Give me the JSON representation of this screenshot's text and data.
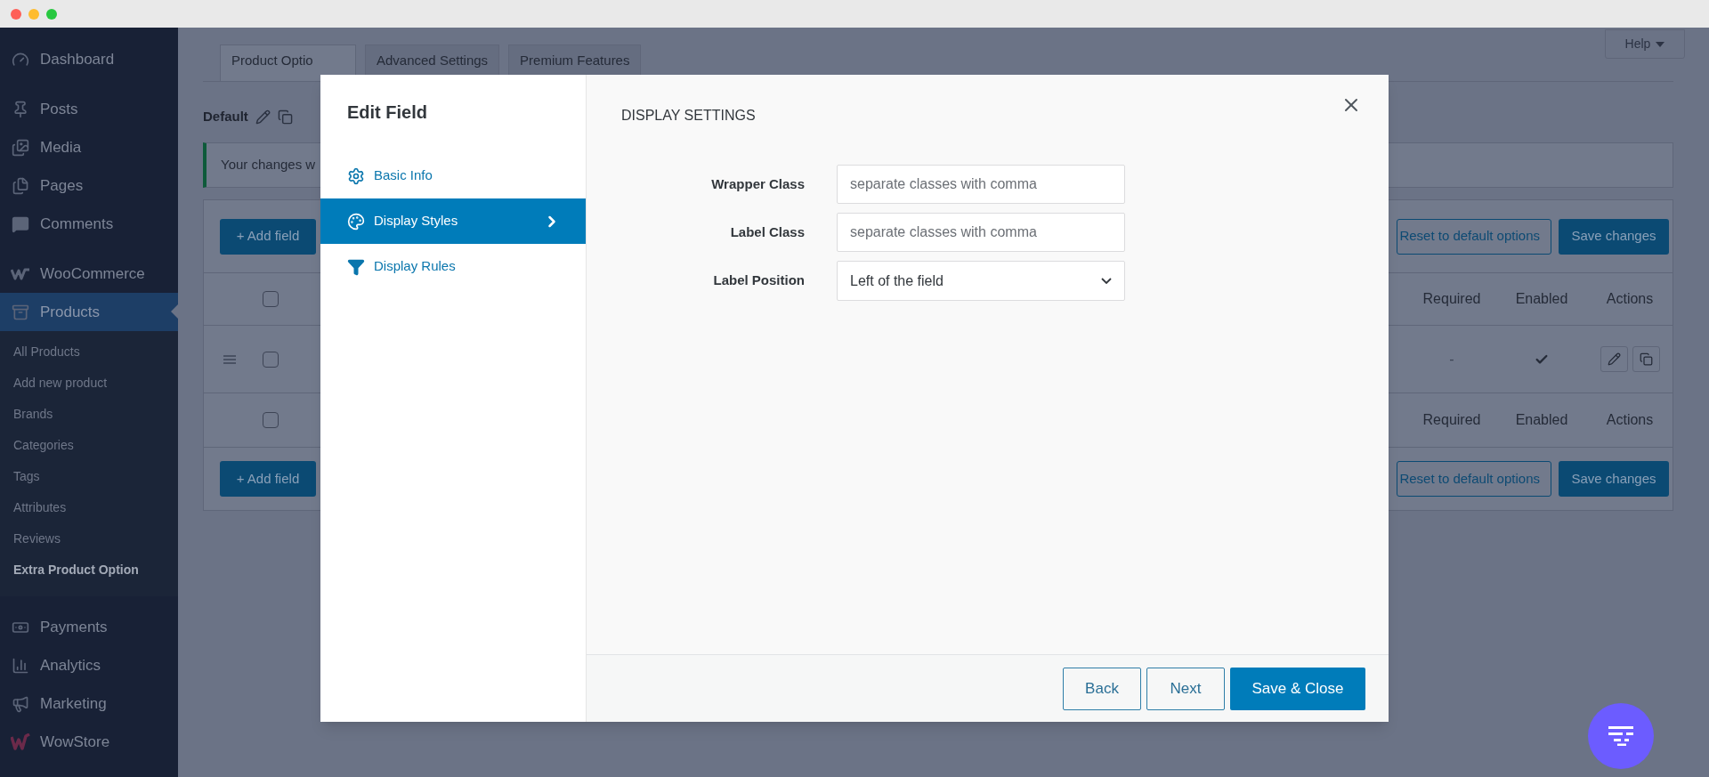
{
  "window": {
    "controls": [
      {
        "color": "#fe5f57"
      },
      {
        "color": "#febc2e"
      },
      {
        "color": "#28c840"
      }
    ]
  },
  "sidebar": {
    "groups": [
      {
        "items": [
          {
            "label": "Dashboard",
            "selected": false
          }
        ]
      },
      {
        "items": [
          {
            "label": "Posts",
            "selected": false
          },
          {
            "label": "Media",
            "selected": false
          },
          {
            "label": "Pages",
            "selected": false
          },
          {
            "label": "Comments",
            "selected": false
          }
        ]
      },
      {
        "items": [
          {
            "label": "WooCommerce",
            "selected": false
          },
          {
            "label": "Products",
            "selected": true,
            "children": [
              {
                "label": "All Products",
                "selected": false
              },
              {
                "label": "Add new product",
                "selected": false
              },
              {
                "label": "Brands",
                "selected": false
              },
              {
                "label": "Categories",
                "selected": false
              },
              {
                "label": "Tags",
                "selected": false
              },
              {
                "label": "Attributes",
                "selected": false
              },
              {
                "label": "Reviews",
                "selected": false
              },
              {
                "label": "Extra Product Option",
                "selected": true
              }
            ]
          }
        ]
      },
      {
        "items": [
          {
            "label": "Payments",
            "selected": false
          },
          {
            "label": "Analytics",
            "selected": false
          },
          {
            "label": "Marketing",
            "selected": false
          },
          {
            "label": "WowStore",
            "selected": false
          }
        ]
      }
    ]
  },
  "help_button": "Help",
  "tabs": [
    {
      "label": "Product Optio",
      "selected": true
    },
    {
      "label": "Advanced Settings",
      "selected": false
    },
    {
      "label": "Premium Features",
      "selected": false
    }
  ],
  "default_bar": {
    "label": "Default"
  },
  "notice": "Your changes w",
  "toolbar_top": {
    "add_button": "+ Add field",
    "reset_button": "Reset to default options",
    "save_button": "Save changes"
  },
  "table": {
    "header": {
      "checked": false,
      "columns": [
        "Required",
        "Enabled",
        "Actions"
      ]
    },
    "rows": [
      {
        "checked": false,
        "required": "-",
        "enabled": true
      }
    ],
    "footer": {
      "checked": false,
      "columns": [
        "Required",
        "Enabled",
        "Actions"
      ]
    }
  },
  "toolbar_bottom": {
    "add_button": "+ Add field",
    "reset_button": "Reset to default options",
    "save_button": "Save changes"
  },
  "modal": {
    "title": "Edit Field",
    "nav": [
      {
        "label": "Basic Info",
        "selected": false
      },
      {
        "label": "Display Styles",
        "selected": true
      },
      {
        "label": "Display Rules",
        "selected": false
      }
    ],
    "section_title": "DISPLAY SETTINGS",
    "fields": [
      {
        "label": "Wrapper Class",
        "kind": "text",
        "placeholder": "separate classes with comma"
      },
      {
        "label": "Label Class",
        "kind": "text",
        "placeholder": "separate classes with comma"
      },
      {
        "label": "Label Position",
        "kind": "select",
        "value": "Left of the field"
      }
    ],
    "buttons": [
      {
        "label": "Back",
        "kind": "secondary"
      },
      {
        "label": "Next",
        "kind": "secondary"
      },
      {
        "label": "Save & Close",
        "kind": "primary"
      }
    ]
  }
}
